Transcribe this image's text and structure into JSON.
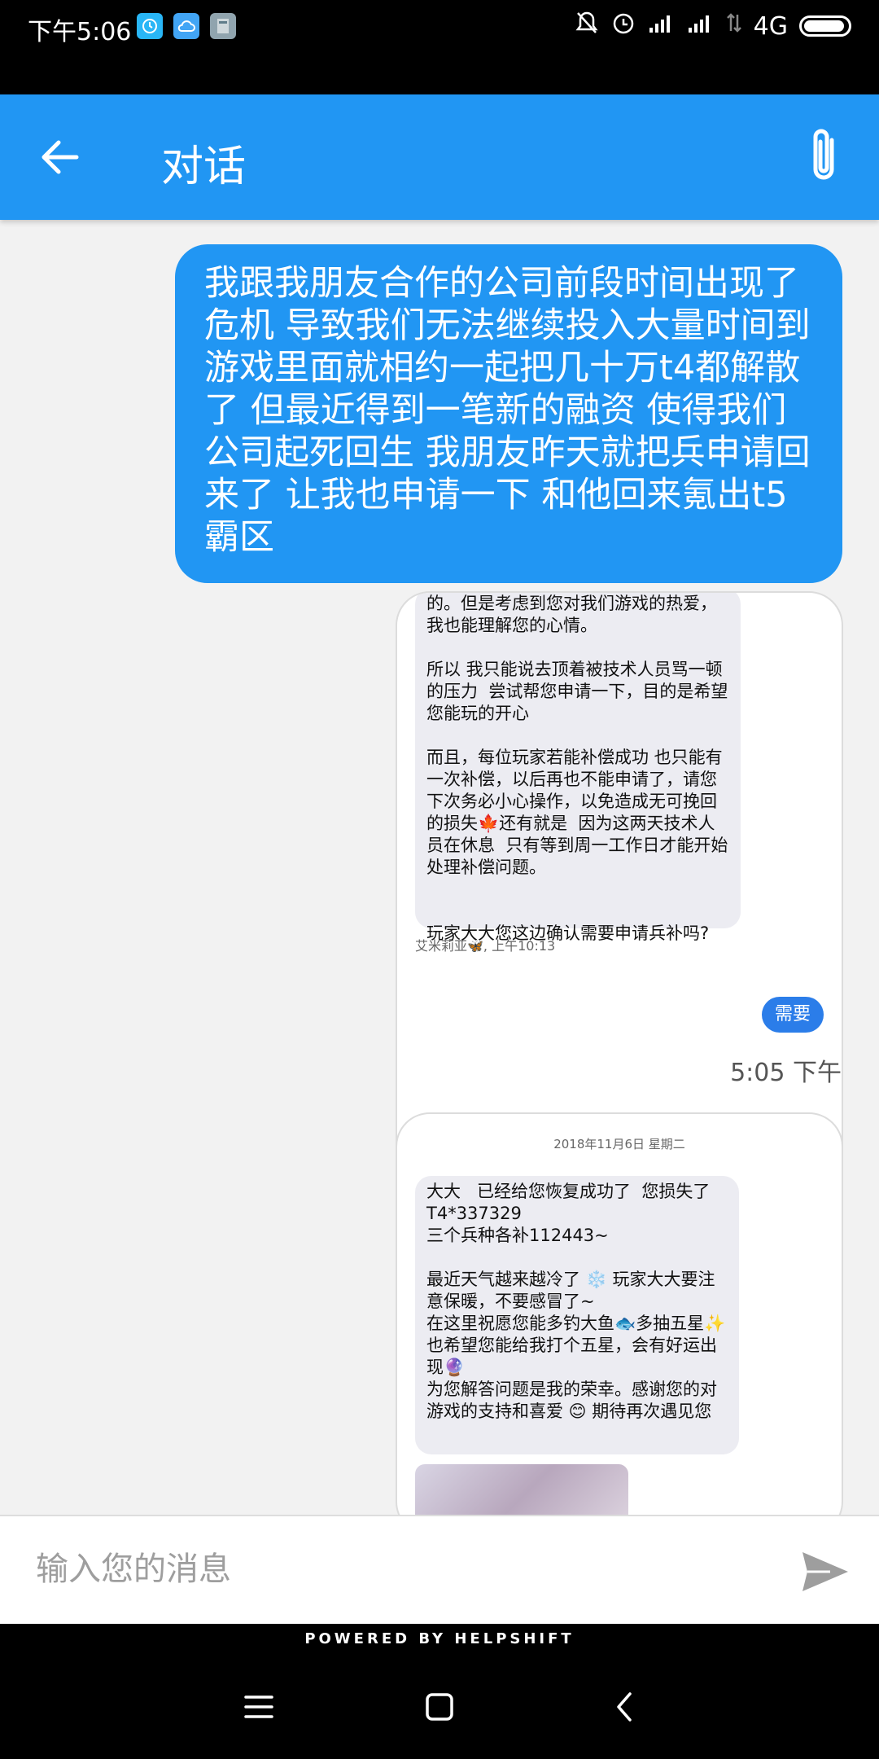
{
  "status_bar": {
    "time": "下午5:06",
    "network": "4G",
    "icons": [
      "clock-app-icon",
      "cloud-icon",
      "notes-icon",
      "mute-icon",
      "alarm-icon",
      "signal-icon",
      "signal-icon",
      "data-icon",
      "battery-icon"
    ]
  },
  "app_bar": {
    "title": "对话",
    "color": "#2196f3"
  },
  "messages": {
    "sent_text": "我跟我朋友合作的公司前段时间出现了危机 导致我们无法继续投入大量时间到游戏里面就相约一起把几十万t4都解散了 但最近得到一笔新的融资 使得我们公司起死回生 我朋友昨天就把兵申请回来了 让我也申请一下 和他回来氪出t5霸区",
    "screenshot1": {
      "text": "的。但是考虑到您对我们游戏的热爱，我也能理解您的心情。\n\n所以 我只能说去顶着被技术人员骂一顿的压力  尝试帮您申请一下，目的是希望您能玩的开心\n\n而且，每位玩家若能补偿成功 也只能有一次补偿，以后再也不能申请了，请您下次务必小心操作，以免造成无可挽回的损失🍁还有就是  因为这两天技术人员在休息  只有等到周一工作日才能开始处理补偿问题。\n\n\n玩家大大您这边确认需要申请兵补吗?",
      "meta": "艾米莉亚🦋, 上午10:13",
      "reply": "需要"
    },
    "time_label": "5:05 下午",
    "screenshot2": {
      "date": "2018年11月6日 星期二",
      "text": "大大   已经给您恢复成功了  您损失了T4*337329\n三个兵种各补112443~\n\n最近天气越来越冷了 ❄️ 玩家大大要注意保暖，不要感冒了~\n在这里祝愿您能多钓大鱼🐟多抽五星✨也希望您能给我打个五星，会有好运出现🔮\n为您解答问题是我的荣幸。感谢您的对游戏的支持和喜爱 😊 期待再次遇见您"
    }
  },
  "input": {
    "placeholder": "输入您的消息"
  },
  "footer": {
    "powered_by": "POWERED BY HELPSHIFT"
  }
}
